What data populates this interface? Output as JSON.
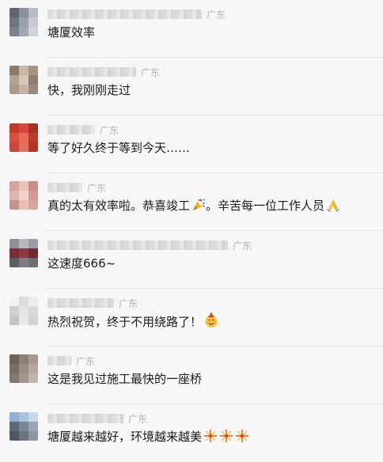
{
  "comments": [
    {
      "location": "广东",
      "text": "塘厦效率",
      "avatar_colors": [
        "#5f6670",
        "#8a909a",
        "#b8bcc4",
        "#6e7480",
        "#9aa0aa",
        "#c8ccd2",
        "#7c828c",
        "#a2a7b0",
        "#d0d3d8"
      ]
    },
    {
      "location": "广东",
      "text": "快，我刚刚走过",
      "avatar_colors": [
        "#8d7a6a",
        "#c9b8a6",
        "#a69482",
        "#b3a18f",
        "#d6c8b8",
        "#8f7e6e",
        "#a89988",
        "#c2b3a2",
        "#9a8a7a"
      ]
    },
    {
      "location": "广东",
      "text": "等了好久终于等到今天……",
      "avatar_colors": [
        "#c23a2e",
        "#d8473a",
        "#a83226",
        "#d9503f",
        "#e86a55",
        "#b93c2f",
        "#c9463a",
        "#e0705e",
        "#b23428"
      ]
    },
    {
      "location": "广东",
      "text": "真的太有效率啦。恭喜竣工",
      "text_after": "。辛苦每一位工作人员",
      "avatar_colors": [
        "#d4a49c",
        "#e8c2b8",
        "#c98f86",
        "#e2b5ab",
        "#f0d2c8",
        "#d39a90",
        "#c8938a",
        "#e6bfb4",
        "#d6a69d"
      ]
    },
    {
      "location": "广东",
      "text": "这速度666~",
      "avatar_colors": [
        "#8b8f96",
        "#b5b8be",
        "#9a9ea5",
        "#7a2e33",
        "#8d3a3f",
        "#6f2a2f",
        "#5a5e66",
        "#7a7e86",
        "#6a6e76"
      ]
    },
    {
      "location": "广东",
      "text": "热烈祝贺，终于不用绕路了！",
      "avatar_colors": [
        "#f2f2f2",
        "#dcdcdc",
        "#ececec",
        "#cfcfcf",
        "#e4e4e4",
        "#d8d8d8",
        "#c4c4c4",
        "#e8e8e8",
        "#d2d2d2"
      ]
    },
    {
      "location": "广东",
      "text": "这是我见过施工最快的一座桥",
      "avatar_colors": [
        "#6f6258",
        "#8e8076",
        "#a89a90",
        "#7a6d63",
        "#9b8d82",
        "#b6a89e",
        "#857870",
        "#a3968c",
        "#c2b5ab"
      ]
    },
    {
      "location": "广东",
      "text": "塘厦越来越好，环境越来越美",
      "avatar_colors": [
        "#8fb0d0",
        "#a8c4de",
        "#c6d8ea",
        "#5f6a76",
        "#7b8794",
        "#9aa6b2",
        "#4c5660",
        "#6a7480",
        "#8c96a0"
      ]
    }
  ],
  "icons": {
    "party_popper": "party-popper-icon",
    "folded_hands": "folded-hands-icon",
    "smiling_face": "face-with-party-hat-icon",
    "fireworks": "fireworks-icon"
  }
}
